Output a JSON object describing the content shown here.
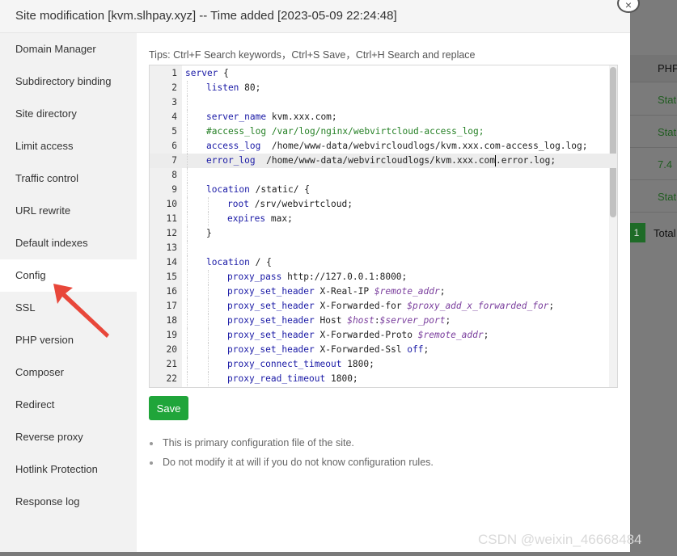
{
  "modal": {
    "title": "Site modification [kvm.slhpay.xyz] -- Time added [2023-05-09 22:24:48]",
    "close_icon": "×"
  },
  "sidebar": {
    "items": [
      {
        "label": "Domain Manager"
      },
      {
        "label": "Subdirectory binding"
      },
      {
        "label": "Site directory"
      },
      {
        "label": "Limit access"
      },
      {
        "label": "Traffic control"
      },
      {
        "label": "URL rewrite"
      },
      {
        "label": "Default indexes"
      },
      {
        "label": "Config",
        "active": true
      },
      {
        "label": "SSL"
      },
      {
        "label": "PHP version"
      },
      {
        "label": "Composer"
      },
      {
        "label": "Redirect"
      },
      {
        "label": "Reverse proxy"
      },
      {
        "label": "Hotlink Protection"
      },
      {
        "label": "Response log"
      }
    ]
  },
  "content": {
    "tips": "Tips: Ctrl+F Search keywords，Ctrl+S Save，Ctrl+H Search and replace",
    "save_label": "Save",
    "notes": [
      "This is primary configuration file of the site.",
      "Do not modify it at will if you do not know configuration rules."
    ]
  },
  "editor": {
    "highlighted_line": 7,
    "lines": [
      {
        "n": "1",
        "indent": 0,
        "parts": [
          [
            "kw",
            "server"
          ],
          [
            "",
            " {"
          ]
        ]
      },
      {
        "n": "2",
        "indent": 1,
        "parts": [
          [
            "kw",
            "listen"
          ],
          [
            "",
            " 80;"
          ]
        ]
      },
      {
        "n": "3",
        "indent": 1,
        "parts": []
      },
      {
        "n": "4",
        "indent": 1,
        "parts": [
          [
            "kw",
            "server_name"
          ],
          [
            "",
            " kvm.xxx.com;"
          ]
        ]
      },
      {
        "n": "5",
        "indent": 1,
        "parts": [
          [
            "cm",
            "#access_log /var/log/nginx/webvirtcloud-access_log;"
          ]
        ]
      },
      {
        "n": "6",
        "indent": 1,
        "parts": [
          [
            "kw",
            "access_log"
          ],
          [
            "",
            "  /home/www-data/webvircloudlogs/kvm.xxx.com-access_log.log;"
          ]
        ]
      },
      {
        "n": "7",
        "indent": 1,
        "parts": [
          [
            "kw",
            "error_log"
          ],
          [
            "",
            "  /home/www-data/webvircloudlogs/kvm.xxx.com"
          ],
          [
            "cursor",
            ""
          ],
          [
            "",
            ".error.log;"
          ]
        ]
      },
      {
        "n": "8",
        "indent": 1,
        "parts": []
      },
      {
        "n": "9",
        "indent": 1,
        "parts": [
          [
            "kw",
            "location"
          ],
          [
            "",
            " /static/ {"
          ]
        ]
      },
      {
        "n": "10",
        "indent": 2,
        "parts": [
          [
            "kw",
            "root"
          ],
          [
            "",
            " /srv/webvirtcloud;"
          ]
        ]
      },
      {
        "n": "11",
        "indent": 2,
        "parts": [
          [
            "kw",
            "expires"
          ],
          [
            "",
            " max;"
          ]
        ]
      },
      {
        "n": "12",
        "indent": 1,
        "parts": [
          [
            "",
            "}"
          ]
        ]
      },
      {
        "n": "13",
        "indent": 1,
        "parts": []
      },
      {
        "n": "14",
        "indent": 1,
        "parts": [
          [
            "kw",
            "location"
          ],
          [
            "",
            " / {"
          ]
        ]
      },
      {
        "n": "15",
        "indent": 2,
        "parts": [
          [
            "kw",
            "proxy_pass"
          ],
          [
            "",
            " http://127.0.0.1:8000;"
          ]
        ]
      },
      {
        "n": "16",
        "indent": 2,
        "parts": [
          [
            "kw",
            "proxy_set_header"
          ],
          [
            "",
            " X-Real-IP "
          ],
          [
            "vr",
            "$remote_addr"
          ],
          [
            "",
            ";"
          ]
        ]
      },
      {
        "n": "17",
        "indent": 2,
        "parts": [
          [
            "kw",
            "proxy_set_header"
          ],
          [
            "",
            " X-Forwarded-for "
          ],
          [
            "vr",
            "$proxy_add_x_forwarded_for"
          ],
          [
            "",
            ";"
          ]
        ]
      },
      {
        "n": "18",
        "indent": 2,
        "parts": [
          [
            "kw",
            "proxy_set_header"
          ],
          [
            "",
            " Host "
          ],
          [
            "vr",
            "$host"
          ],
          [
            "",
            ":"
          ],
          [
            "vr",
            "$server_port"
          ],
          [
            "",
            ";"
          ]
        ]
      },
      {
        "n": "19",
        "indent": 2,
        "parts": [
          [
            "kw",
            "proxy_set_header"
          ],
          [
            "",
            " X-Forwarded-Proto "
          ],
          [
            "vr",
            "$remote_addr"
          ],
          [
            "",
            ";"
          ]
        ]
      },
      {
        "n": "20",
        "indent": 2,
        "parts": [
          [
            "kw",
            "proxy_set_header"
          ],
          [
            "",
            " X-Forwarded-Ssl "
          ],
          [
            "kw",
            "off"
          ],
          [
            "",
            ";"
          ]
        ]
      },
      {
        "n": "21",
        "indent": 2,
        "parts": [
          [
            "kw",
            "proxy_connect_timeout"
          ],
          [
            "",
            " 1800;"
          ]
        ]
      },
      {
        "n": "22",
        "indent": 2,
        "parts": [
          [
            "kw",
            "proxy_read_timeout"
          ],
          [
            "",
            " 1800;"
          ]
        ]
      }
    ]
  },
  "background": {
    "col_header": "PHP",
    "rows": [
      "Stati",
      "Stati",
      "7.4",
      "Stati"
    ],
    "page_num": "1",
    "total_label": "Total"
  },
  "watermark": "CSDN @weixin_46668484",
  "colors": {
    "accent": "#20a53a",
    "arrow": "#e8473a"
  }
}
